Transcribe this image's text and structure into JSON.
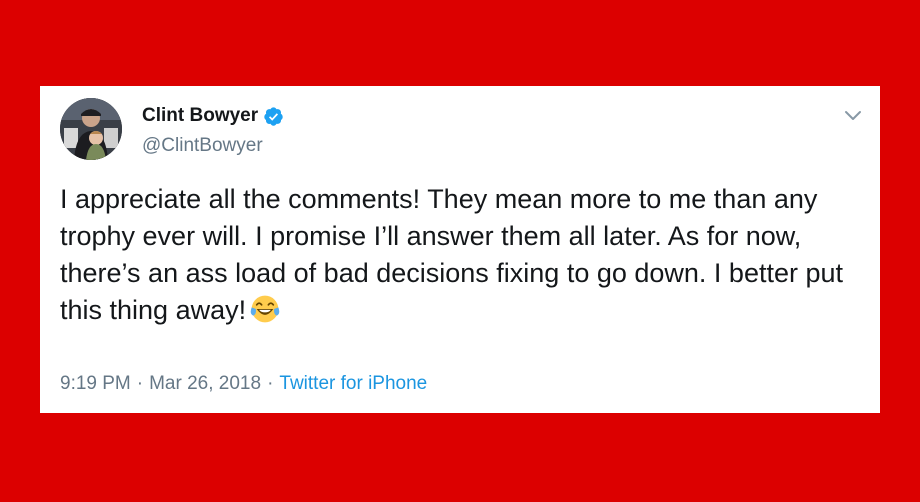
{
  "tweet": {
    "author": {
      "display_name": "Clint Bowyer",
      "handle": "@ClintBowyer",
      "verified": true
    },
    "text": "I appreciate all the comments! They mean more to me than any trophy ever will. I promise I’ll answer them all later. As for now, there’s an ass load of bad decisions fixing to go down. I better put this thing away!",
    "emoji": "face-with-tears-of-joy-icon",
    "time": "9:19 PM",
    "separator": "·",
    "date": "Mar 26, 2018",
    "source": "Twitter for iPhone"
  },
  "colors": {
    "background": "#dc0000",
    "card": "#ffffff",
    "text": "#14171a",
    "muted": "#657786",
    "link": "#1b95e0",
    "verified": "#1da1f2"
  }
}
